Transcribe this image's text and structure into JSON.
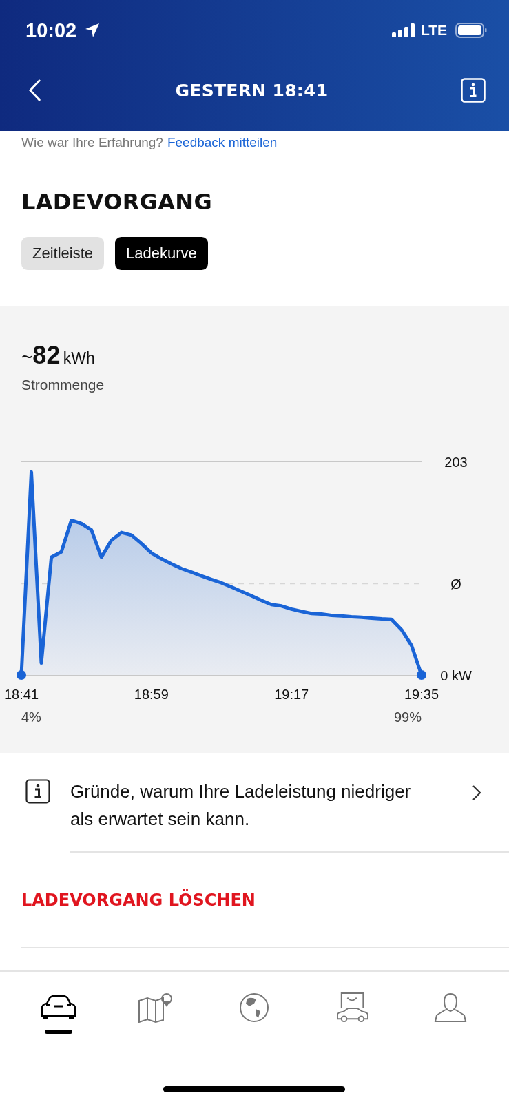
{
  "status_bar": {
    "time": "10:02",
    "network": "LTE"
  },
  "header": {
    "title": "GESTERN 18:41"
  },
  "feedback": {
    "question": "Wie war Ihre Erfahrung?",
    "link": "Feedback mitteilen"
  },
  "section_title": "LADEVORGANG",
  "tabs": [
    {
      "label": "Zeitleiste",
      "selected": false
    },
    {
      "label": "Ladekurve",
      "selected": true
    }
  ],
  "energy": {
    "prefix": "~",
    "value": "82",
    "unit": "kWh",
    "label": "Strommenge"
  },
  "chart": {
    "chart_data": {
      "type": "area",
      "categories": [
        "18:41",
        null,
        null,
        null,
        null,
        null,
        null,
        null,
        null,
        null,
        null,
        null,
        null,
        "18:59",
        null,
        null,
        null,
        null,
        null,
        null,
        null,
        null,
        null,
        null,
        null,
        null,
        null,
        "19:17",
        null,
        null,
        null,
        null,
        null,
        null,
        null,
        null,
        null,
        null,
        null,
        null,
        "19:35"
      ],
      "series": [
        {
          "color": "#1a64d6",
          "values": [
            0,
            193,
            11.4,
            112,
            117,
            147,
            144,
            138,
            112,
            128,
            135.5,
            133,
            125,
            116,
            110.5,
            105.6,
            101.2,
            97.8,
            94.2,
            90.8,
            87.6,
            83.7,
            79.4,
            75.3,
            70.9,
            67,
            65.6,
            62.6,
            60.4,
            58.4,
            57.9,
            56.6,
            56.1,
            55.3,
            54.9,
            54.1,
            53.4,
            52.9,
            43.1,
            28,
            0
          ]
        }
      ],
      "ylim": [
        0,
        203
      ],
      "yticks": [
        {
          "value": 203,
          "label": "203"
        },
        {
          "value": 87,
          "label": "Ø"
        },
        {
          "value": 0,
          "label": "0 kW"
        }
      ]
    },
    "start_soc": "4%",
    "end_soc": "99%"
  },
  "info_row": {
    "text": "Gründe, warum Ihre Ladeleistung niedriger als erwartet sein kann."
  },
  "delete_action": "LADEVORGANG LÖSCHEN",
  "bottom_nav": [
    {
      "selected": true
    },
    {
      "selected": false
    },
    {
      "selected": false
    },
    {
      "selected": false
    },
    {
      "selected": false
    }
  ]
}
